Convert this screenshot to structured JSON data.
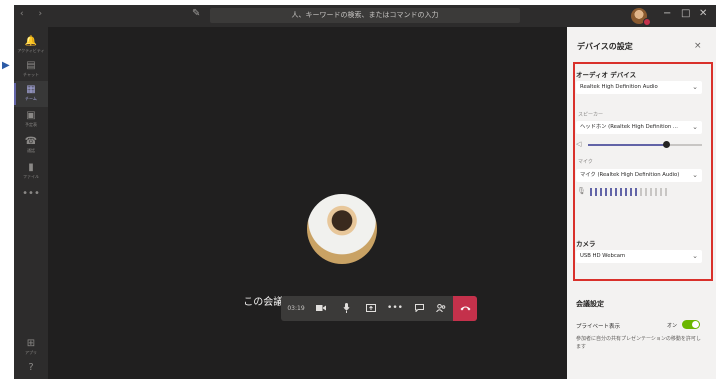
{
  "topbar": {
    "nav_arrows": "‹ ›",
    "search_placeholder": "人、キーワードの検索、またはコマンドの入力",
    "window_controls": [
      "−",
      "□",
      "✕"
    ]
  },
  "rail": {
    "items": [
      {
        "icon": "bell-icon",
        "glyph": "🔔",
        "label": "アクティビティ"
      },
      {
        "icon": "chat-icon",
        "glyph": "▤",
        "label": "チャット"
      },
      {
        "icon": "teams-icon",
        "glyph": "▦",
        "label": "チーム"
      },
      {
        "icon": "calendar-icon",
        "glyph": "▣",
        "label": "予定表"
      },
      {
        "icon": "phone-icon",
        "glyph": "☎",
        "label": "通話"
      },
      {
        "icon": "file-icon",
        "glyph": "▮",
        "label": "ファイル"
      },
      {
        "icon": "more-icon",
        "glyph": "•••",
        "label": ""
      }
    ],
    "bottom": [
      {
        "icon": "apps-icon",
        "glyph": "⊞",
        "label": "アプリ"
      },
      {
        "icon": "help-icon",
        "glyph": "?",
        "label": ""
      }
    ]
  },
  "stage": {
    "message": "この会議に参加している人は他にいません。",
    "call_timer": "03:19"
  },
  "callbar": {
    "camera_icon": "camera-icon",
    "mic_icon": "mic-icon",
    "share_icon": "share-icon",
    "more_glyph": "•••",
    "chat_icon": "chat-icon",
    "people_icon": "people-icon",
    "hangup_icon": "hangup-icon"
  },
  "device_panel": {
    "title": "デバイスの設定",
    "close": "×",
    "audio_label": "オーディオ デバイス",
    "audio_device": "Realtek High Definition Audio",
    "speaker_label": "スピーカー",
    "speaker_device": "ヘッドホン (Realtek High Definition ...",
    "speaker_volume": 0.68,
    "mic_label": "マイク",
    "mic_device": "マイク (Realtek High Definition Audio)",
    "mic_level_bars": 16,
    "mic_level_active": 10,
    "camera_label": "カメラ",
    "camera_device": "USB HD Webcam",
    "meeting_label": "会議設定",
    "private_label": "プライベート表示",
    "private_toggle_text": "オン",
    "private_desc": "参加者に自分の共有プレゼンテーションの移動を許可します"
  },
  "colors": {
    "accent": "#6264a7",
    "highlight_box": "#d9312b",
    "hangup": "#c4314b",
    "toggle_on": "#6bb700"
  }
}
